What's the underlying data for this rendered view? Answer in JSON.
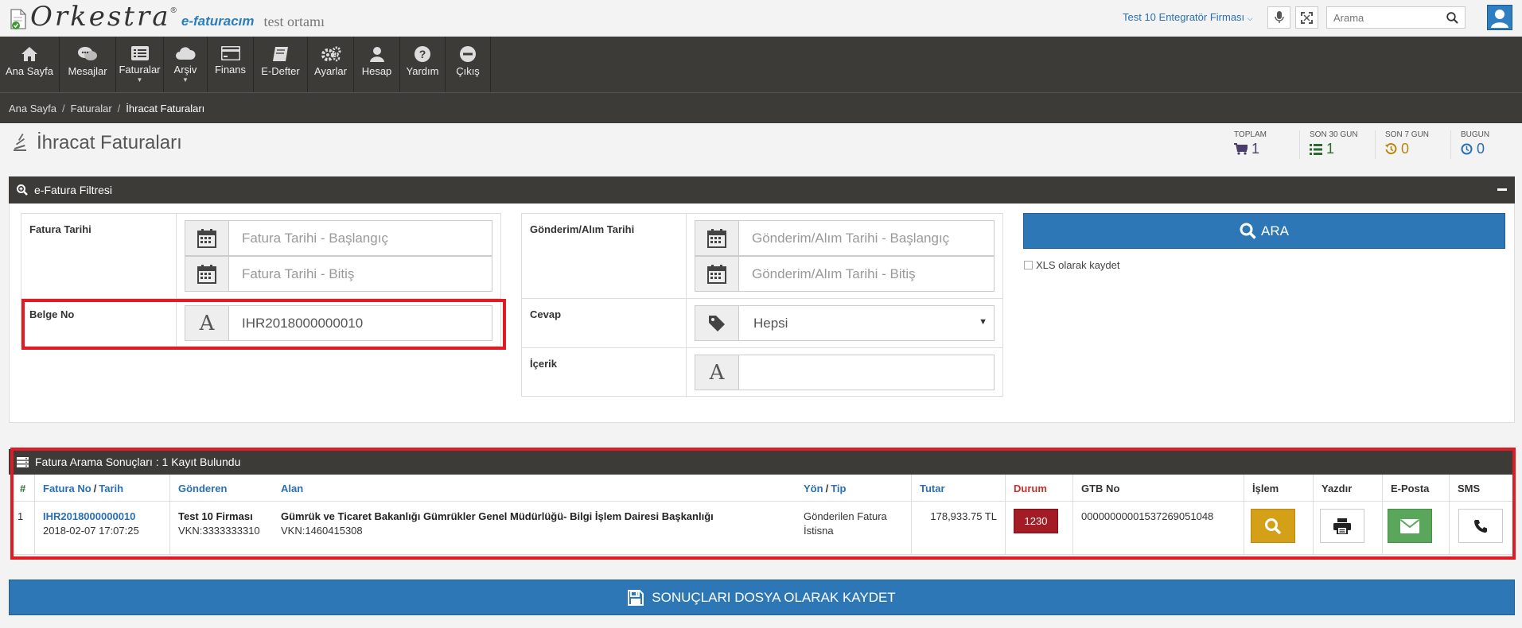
{
  "brand": {
    "name": "Orkestra",
    "reg": "®",
    "product": "e-faturacım",
    "env": "test ortamı"
  },
  "topbar": {
    "company": "Test 10 Entegratör Firması",
    "search_placeholder": "Arama",
    "icons": [
      "microphone-icon",
      "fullscreen-icon",
      "search-icon",
      "user-icon"
    ]
  },
  "nav": [
    {
      "label": "Ana Sayfa",
      "icon": "home-icon"
    },
    {
      "label": "Mesajlar",
      "icon": "comments-icon"
    },
    {
      "label": "Faturalar",
      "icon": "list-icon",
      "caret": true
    },
    {
      "label": "Arşiv",
      "icon": "cloud-icon",
      "caret": true
    },
    {
      "label": "Finans",
      "icon": "credit-card-icon"
    },
    {
      "label": "E-Defter",
      "icon": "book-icon"
    },
    {
      "label": "Ayarlar",
      "icon": "gears-icon"
    },
    {
      "label": "Hesap",
      "icon": "user-icon"
    },
    {
      "label": "Yardım",
      "icon": "help-icon"
    },
    {
      "label": "Çıkış",
      "icon": "minus-circle-icon"
    }
  ],
  "breadcrumb": [
    "Ana Sayfa",
    "Faturalar",
    "İhracat Faturaları"
  ],
  "page_title": "İhracat Faturaları",
  "stats": [
    {
      "label": "TOPLAM",
      "value": "1",
      "color": "#4b3d6b"
    },
    {
      "label": "SON 30 GUN",
      "value": "1",
      "color": "#2d6b2d"
    },
    {
      "label": "SON 7 GUN",
      "value": "0",
      "color": "#b8860b"
    },
    {
      "label": "BUGUN",
      "value": "0",
      "color": "#2a6fb5"
    }
  ],
  "filter": {
    "title": "e-Fatura Filtresi",
    "fatura_tarihi_label": "Fatura Tarihi",
    "fatura_start_placeholder": "Fatura Tarihi - Başlangıç",
    "fatura_end_placeholder": "Fatura Tarihi - Bitiş",
    "belge_no_label": "Belge No",
    "belge_no_value": "IHR2018000000010",
    "gonderim_label": "Gönderim/Alım Tarihi",
    "gonderim_start_placeholder": "Gönderim/Alım Tarihi - Başlangıç",
    "gonderim_end_placeholder": "Gönderim/Alım Tarihi - Bitiş",
    "cevap_label": "Cevap",
    "cevap_value": "Hepsi",
    "icerik_label": "İçerik",
    "icerik_value": "",
    "search_button": "ARA",
    "xls_label": "XLS olarak kaydet"
  },
  "results": {
    "title": "Fatura Arama Sonuçları : 1 Kayıt Bulundu",
    "headers": {
      "num": "#",
      "fatura_no": "Fatura No",
      "slash": "/",
      "tarih": "Tarih",
      "gonderen": "Gönderen",
      "alan": "Alan",
      "yon": "Yön",
      "tip": "Tip",
      "tutar": "Tutar",
      "durum": "Durum",
      "gtb": "GTB No",
      "islem": "İşlem",
      "yazdir": "Yazdır",
      "eposta": "E-Posta",
      "sms": "SMS"
    },
    "rows": [
      {
        "num": "1",
        "fatura_no": "IHR2018000000010",
        "tarih": "2018-02-07 17:07:25",
        "gonderen_name": "Test 10 Firması",
        "gonderen_vkn": "VKN:3333333310",
        "alan_name": "Gümrük ve Ticaret Bakanlığı Gümrükler Genel Müdürlüğü- Bilgi İşlem Dairesi Başkanlığı",
        "alan_vkn": "VKN:1460415308",
        "yon": "Gönderilen Fatura",
        "tip": "İstisna",
        "tutar": "178,933.75 TL",
        "durum": "1230",
        "gtb": "00000000001537269051048"
      }
    ],
    "durum_color": "#a31b24"
  },
  "save_button": "SONUÇLARI DOSYA OLARAK KAYDET"
}
